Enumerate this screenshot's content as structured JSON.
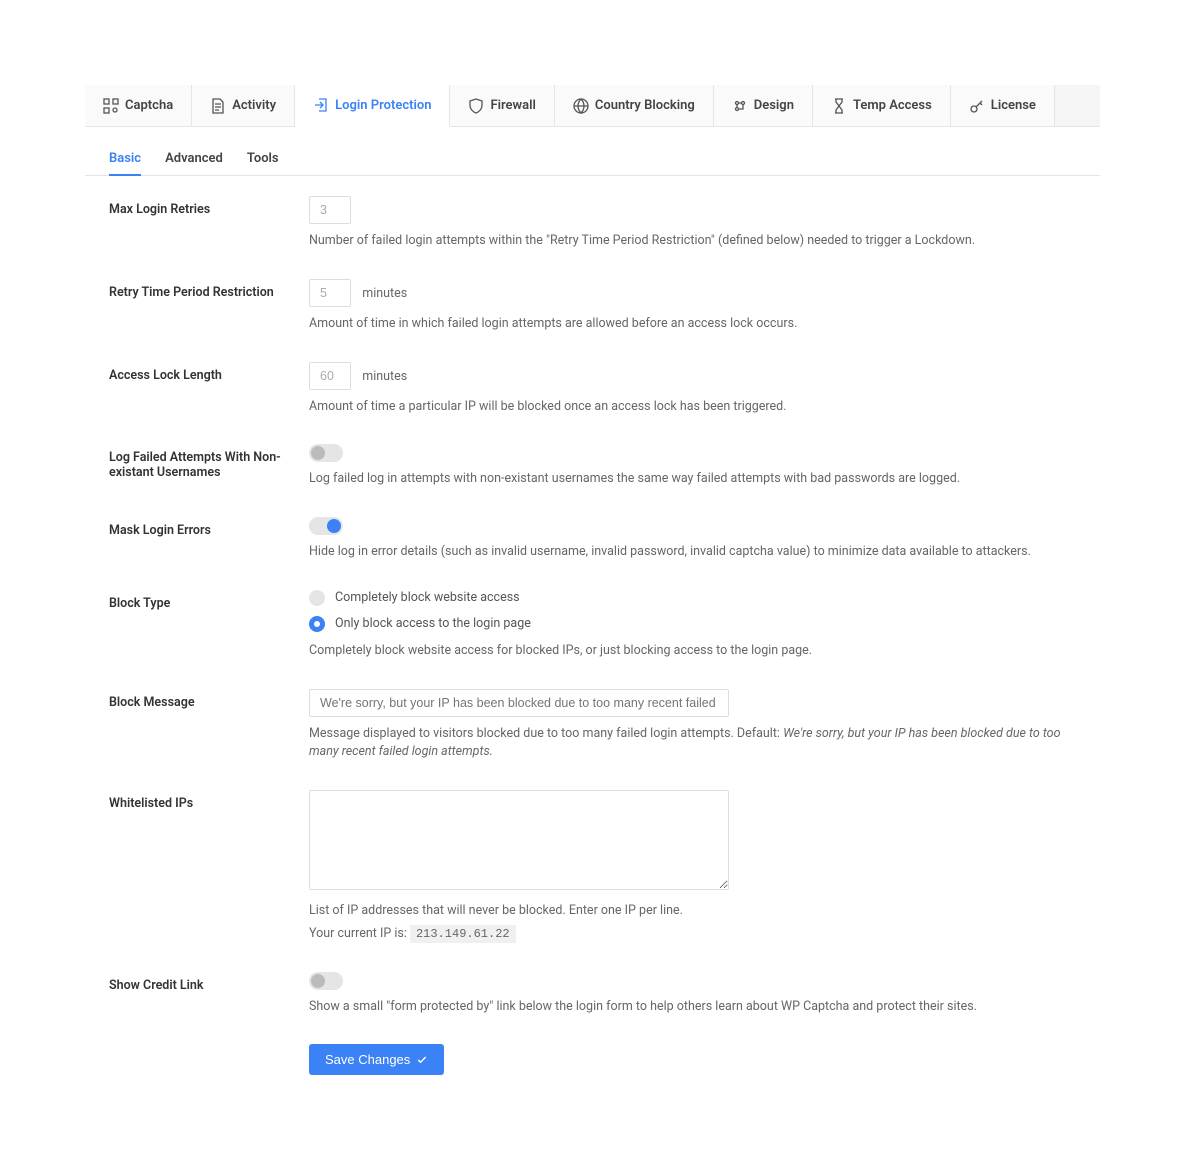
{
  "mainTabs": [
    {
      "label": "Captcha",
      "icon": "captcha-icon",
      "active": false
    },
    {
      "label": "Activity",
      "icon": "file-icon",
      "active": false
    },
    {
      "label": "Login Protection",
      "icon": "login-icon",
      "active": true
    },
    {
      "label": "Firewall",
      "icon": "shield-icon",
      "active": false
    },
    {
      "label": "Country Blocking",
      "icon": "globe-icon",
      "active": false
    },
    {
      "label": "Design",
      "icon": "design-icon",
      "active": false
    },
    {
      "label": "Temp Access",
      "icon": "hourglass-icon",
      "active": false
    },
    {
      "label": "License",
      "icon": "key-icon",
      "active": false
    }
  ],
  "subTabs": [
    {
      "label": "Basic",
      "active": true
    },
    {
      "label": "Advanced",
      "active": false
    },
    {
      "label": "Tools",
      "active": false
    }
  ],
  "fields": {
    "maxRetries": {
      "label": "Max Login Retries",
      "value": "3",
      "help": "Number of failed login attempts within the \"Retry Time Period Restriction\" (defined below) needed to trigger a Lockdown."
    },
    "retryPeriod": {
      "label": "Retry Time Period Restriction",
      "value": "5",
      "suffix": "minutes",
      "help": "Amount of time in which failed login attempts are allowed before an access lock occurs."
    },
    "lockLength": {
      "label": "Access Lock Length",
      "value": "60",
      "suffix": "minutes",
      "help": "Amount of time a particular IP will be blocked once an access lock has been triggered."
    },
    "logFailed": {
      "label": "Log Failed Attempts With Non-existant Usernames",
      "on": false,
      "help": "Log failed log in attempts with non-existant usernames the same way failed attempts with bad passwords are logged."
    },
    "maskErrors": {
      "label": "Mask Login Errors",
      "on": true,
      "help": "Hide log in error details (such as invalid username, invalid password, invalid captcha value) to minimize data available to attackers."
    },
    "blockType": {
      "label": "Block Type",
      "options": [
        {
          "label": "Completely block website access",
          "selected": false
        },
        {
          "label": "Only block access to the login page",
          "selected": true
        }
      ],
      "help": "Completely block website access for blocked IPs, or just blocking access to the login page."
    },
    "blockMessage": {
      "label": "Block Message",
      "placeholder": "We're sorry, but your IP has been blocked due to too many recent failed login attempts.",
      "helpPrefix": "Message displayed to visitors blocked due to too many failed login attempts. Default: ",
      "helpItalic": "We're sorry, but your IP has been blocked due to too many recent failed login attempts."
    },
    "whitelistedIPs": {
      "label": "Whitelisted IPs",
      "value": "",
      "help": "List of IP addresses that will never be blocked. Enter one IP per line.",
      "ipPrefix": "Your current IP is: ",
      "ip": "213.149.61.22"
    },
    "creditLink": {
      "label": "Show Credit Link",
      "on": false,
      "help": "Show a small \"form protected by\" link below the login form to help others learn about WP Captcha and protect their sites."
    }
  },
  "saveButton": "Save Changes"
}
